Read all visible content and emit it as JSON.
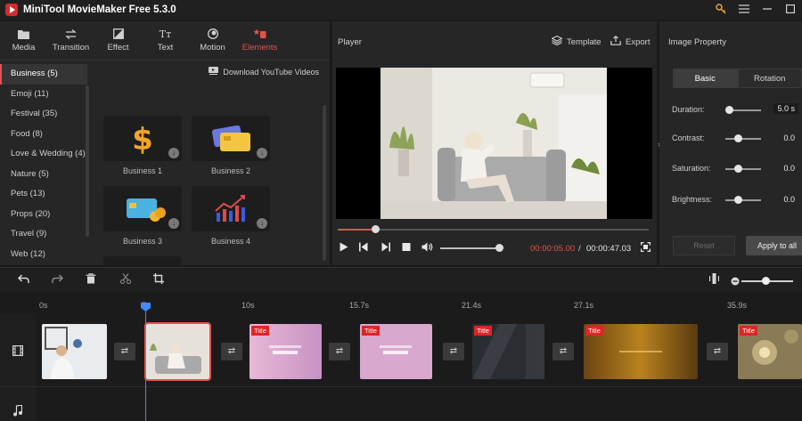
{
  "app": {
    "title": "MiniTool MovieMaker Free 5.3.0"
  },
  "window_controls": [
    "key-icon",
    "menu-icon",
    "minimize-icon",
    "maximize-icon"
  ],
  "toolbar": {
    "tabs": [
      {
        "label": "Media",
        "icon": "media-icon"
      },
      {
        "label": "Transition",
        "icon": "transition-icon"
      },
      {
        "label": "Effect",
        "icon": "effect-icon"
      },
      {
        "label": "Text",
        "icon": "text-icon"
      },
      {
        "label": "Motion",
        "icon": "motion-icon"
      },
      {
        "label": "Elements",
        "icon": "elements-icon",
        "active": true
      }
    ]
  },
  "categories": [
    "Business (5)",
    "Emoji (11)",
    "Festival (35)",
    "Food (8)",
    "Love & Wedding (4)",
    "Nature (5)",
    "Pets (13)",
    "Props (20)",
    "Travel (9)",
    "Web (12)"
  ],
  "selected_category": "Business (5)",
  "download_link": "Download YouTube Videos",
  "elements": [
    {
      "label": "Business 1",
      "icon": "dollar-icon"
    },
    {
      "label": "Business 2",
      "icon": "bank-cards-icon"
    },
    {
      "label": "Business 3",
      "icon": "bank-card-coins-icon"
    },
    {
      "label": "Business 4",
      "icon": "growth-chart-icon"
    },
    {
      "label": "",
      "icon": "handshake-icon"
    }
  ],
  "player": {
    "label": "Player",
    "template_label": "Template",
    "export_label": "Export",
    "current_time": "00:00:05.00",
    "separator": "/",
    "total_time": "00:00:47.03",
    "progress_fraction": 0.12,
    "volume_fraction": 0.9
  },
  "properties": {
    "title": "Image Property",
    "tabs": [
      "Basic",
      "Rotation"
    ],
    "active_tab": "Basic",
    "rows": [
      {
        "label": "Duration:",
        "value": "5.0 s",
        "slider": 0.2
      },
      {
        "label": "Contrast:",
        "value": "0.0",
        "slider": 0.5
      },
      {
        "label": "Saturation:",
        "value": "0.0",
        "slider": 0.5
      },
      {
        "label": "Brightness:",
        "value": "0.0",
        "slider": 0.5
      }
    ],
    "reset_label": "Reset",
    "apply_label": "Apply to all"
  },
  "timeline": {
    "tools": [
      "undo-icon",
      "redo-icon",
      "delete-icon",
      "split-icon",
      "crop-icon"
    ],
    "ruler": [
      "0s",
      "5s",
      "10s",
      "15.7s",
      "21.4s",
      "27.1s",
      "35.9s"
    ],
    "clip_tag": "Title",
    "clips": [
      {
        "type": "photo-doctor"
      },
      {
        "type": "photo-woman",
        "selected": true
      },
      {
        "type": "title",
        "tag": "Title"
      },
      {
        "type": "title",
        "tag": "Title"
      },
      {
        "type": "title-dark",
        "tag": "Title"
      },
      {
        "type": "title-amber",
        "tag": "Title"
      },
      {
        "type": "title-bokeh",
        "tag": "Title"
      }
    ]
  },
  "colors": {
    "accent": "#e0544b",
    "playhead": "#3d8bfd",
    "panel": "#262627"
  }
}
